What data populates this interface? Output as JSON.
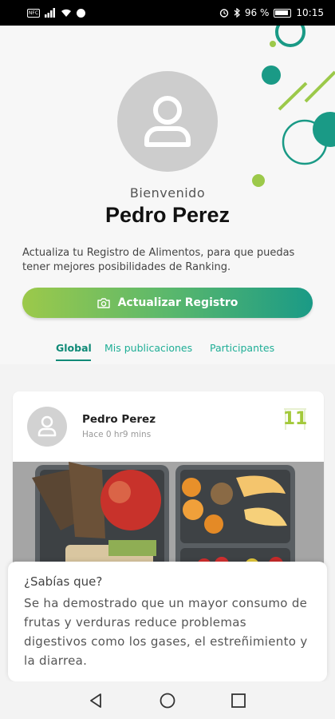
{
  "status_bar": {
    "battery": "96 %",
    "time": "10:15",
    "sim_label": "NFC"
  },
  "profile": {
    "welcome": "Bienvenido",
    "name": "Pedro Perez",
    "description": "Actualiza tu Registro de Alimentos, para que puedas tener mejores posibilidades de Ranking.",
    "update_button": "Actualizar Registro"
  },
  "tabs": [
    {
      "label": "Global",
      "active": true
    },
    {
      "label": "Mis publicaciones",
      "active": false
    },
    {
      "label": "Participantes",
      "active": false
    }
  ],
  "post": {
    "author": "Pedro Perez",
    "time": "Hace 0 hr9 mins",
    "rank": "11"
  },
  "tip": {
    "title": "¿Sabías que?",
    "body": "Se ha demostrado que un mayor consumo de frutas y verduras reduce problemas digestivos como los gases, el estreñimiento y la diarrea."
  },
  "colors": {
    "accent_teal": "#1a9a86",
    "accent_green": "#9cc94a",
    "rank_green": "#a3c93a"
  },
  "icons": [
    "camera-icon",
    "user-icon",
    "back-icon",
    "home-icon",
    "recents-icon"
  ]
}
